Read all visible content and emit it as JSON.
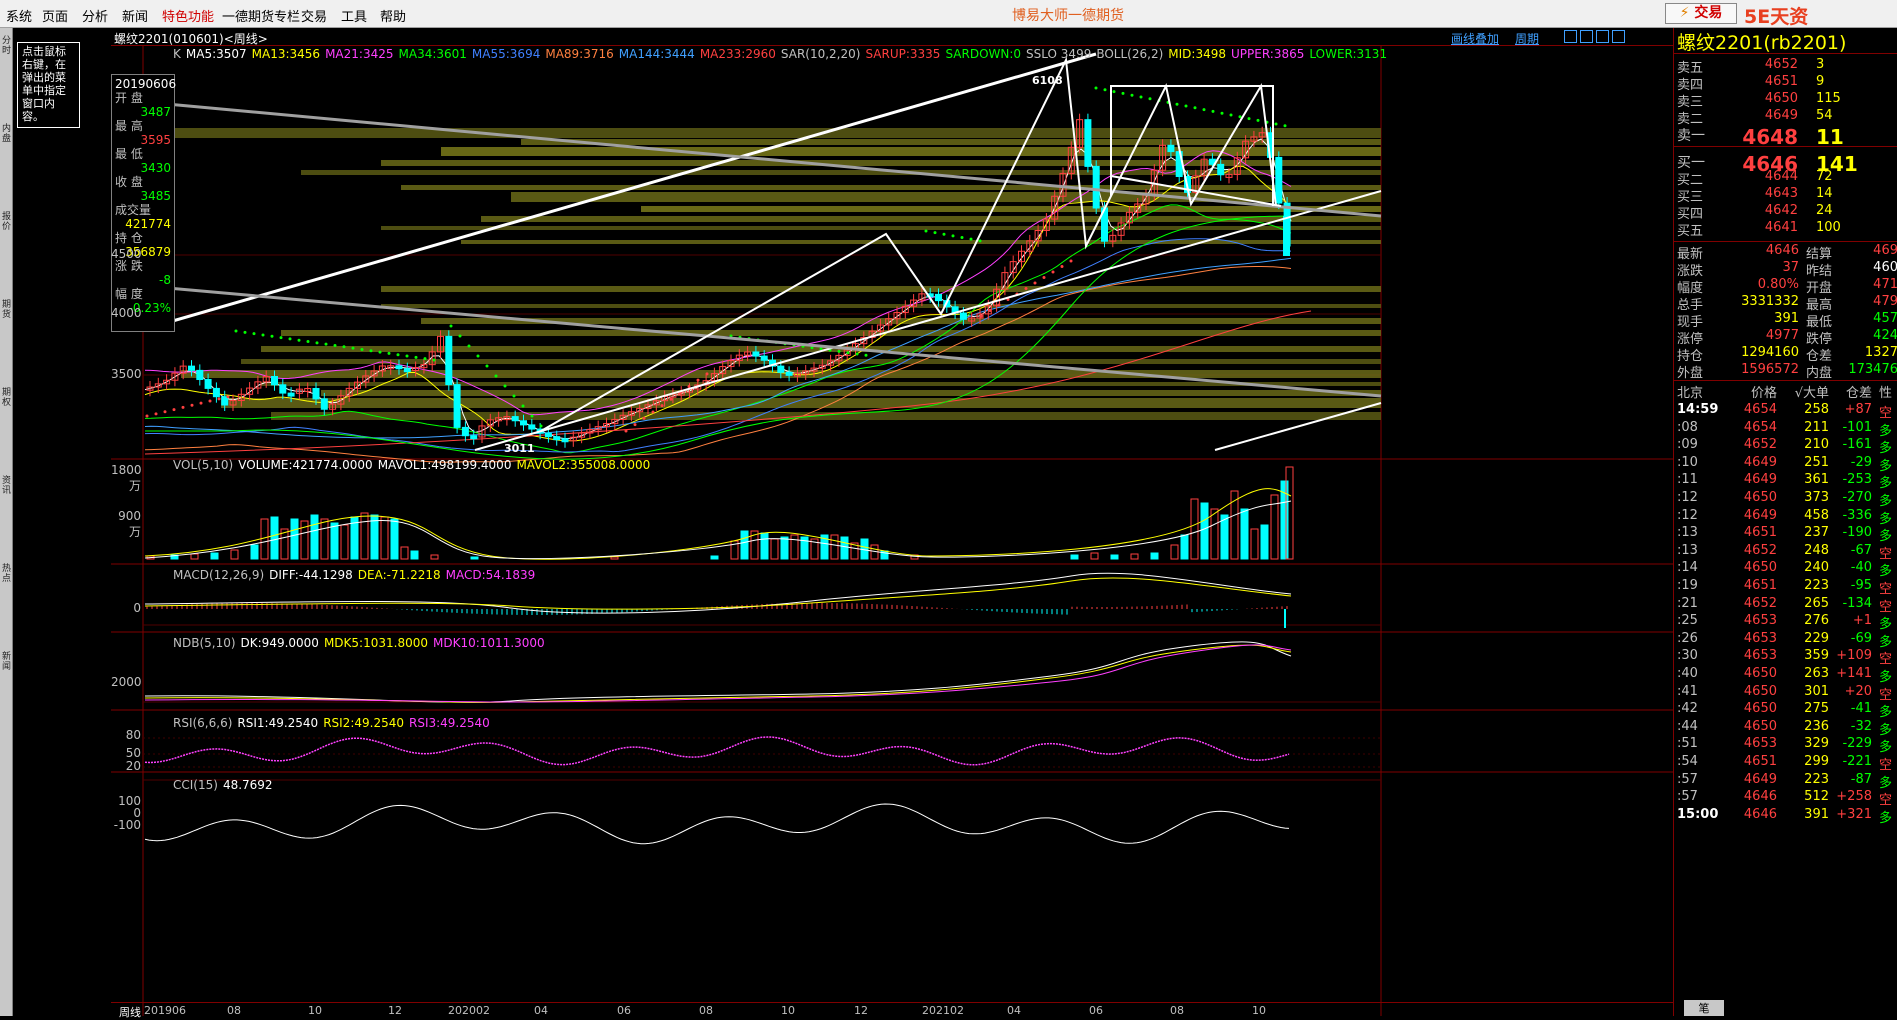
{
  "menu": [
    "系统",
    "页面",
    "分析",
    "新闻",
    "特色功能",
    "一德期货专栏",
    "交易",
    "工具",
    "帮助"
  ],
  "app_title": "博易大师一德期货",
  "trade_button": "交易",
  "watermark": "5E天资5etz.com",
  "left_tabs": [
    "分时",
    "内盘",
    "报价",
    "期货",
    "期权",
    "资讯",
    "热点",
    "新闻"
  ],
  "info_box": "点击鼠标右键，在弹出的菜单中指定窗口内容。",
  "chart": {
    "title": "螺纹2201(010601)<周线>",
    "links": [
      "画线叠加",
      "周期"
    ],
    "ma_line": [
      {
        "t": "K",
        "c": "#c0c0c0"
      },
      {
        "t": "MA5:3507",
        "c": "#ffffff"
      },
      {
        "t": "MA13:3456",
        "c": "#ffff00"
      },
      {
        "t": "MA21:3425",
        "c": "#ff40ff"
      },
      {
        "t": "MA34:3601",
        "c": "#00ff00"
      },
      {
        "t": "MA55:3694",
        "c": "#4080ff"
      },
      {
        "t": "MA89:3716",
        "c": "#ff8040"
      },
      {
        "t": "MA144:3444",
        "c": "#40a0ff"
      },
      {
        "t": "MA233:2960",
        "c": "#ff4040"
      },
      {
        "t": "SAR(10,2,20)",
        "c": "#c0c0c0"
      },
      {
        "t": "SARUP:3335",
        "c": "#ff4040"
      },
      {
        "t": "SARDOWN:0",
        "c": "#00ff00"
      },
      {
        "t": "SSLO 3499",
        "c": "#c0c0c0"
      },
      {
        "t": "BOLL(26,2)",
        "c": "#c0c0c0"
      },
      {
        "t": "MID:3498",
        "c": "#ffff00"
      },
      {
        "t": "UPPER:3865",
        "c": "#ff40ff"
      },
      {
        "t": "LOWER:3131",
        "c": "#00ff00"
      }
    ],
    "ohlc": [
      {
        "label": "20190606",
        "value": ""
      },
      {
        "label": "开  盘",
        "value": "3487",
        "color": "#00ff00"
      },
      {
        "label": "最  高",
        "value": "3595",
        "color": "#ff4040"
      },
      {
        "label": "最  低",
        "value": "3430",
        "color": "#00ff00"
      },
      {
        "label": "收  盘",
        "value": "3485",
        "color": "#00ff00"
      },
      {
        "label": "成交量",
        "value": "421774",
        "color": "#ffff00"
      },
      {
        "label": "持  仓",
        "value": "356879",
        "color": "#ffff00"
      },
      {
        "label": "涨  跌",
        "value": "-8",
        "color": "#00ff00"
      },
      {
        "label": "幅  度",
        "value": "-0.23%",
        "color": "#00ff00"
      }
    ],
    "price_ticks": [
      "4500",
      "4000",
      "3500"
    ],
    "annot_high": "6108",
    "annot_low": "3011",
    "vol": {
      "line": [
        {
          "t": "VOL(5,10)",
          "c": "#c0c0c0"
        },
        {
          "t": "VOLUME:421774.0000",
          "c": "#ffffff"
        },
        {
          "t": "MAVOL1:498199.4000",
          "c": "#ffffff"
        },
        {
          "t": "MAVOL2:355008.0000",
          "c": "#ffff00"
        }
      ],
      "ticks": [
        "1800万",
        "900万"
      ]
    },
    "macd": {
      "line": [
        {
          "t": "MACD(12,26,9)",
          "c": "#c0c0c0"
        },
        {
          "t": "DIFF:-44.1298",
          "c": "#ffffff"
        },
        {
          "t": "DEA:-71.2218",
          "c": "#ffff00"
        },
        {
          "t": "MACD:54.1839",
          "c": "#ff40ff"
        }
      ],
      "ticks": [
        "0"
      ]
    },
    "ndb": {
      "line": [
        {
          "t": "NDB(5,10)",
          "c": "#c0c0c0"
        },
        {
          "t": "DK:949.0000",
          "c": "#ffffff"
        },
        {
          "t": "MDK5:1031.8000",
          "c": "#ffff00"
        },
        {
          "t": "MDK10:1011.3000",
          "c": "#ff40ff"
        }
      ],
      "ticks": [
        "2000"
      ]
    },
    "rsi": {
      "line": [
        {
          "t": "RSI(6,6,6)",
          "c": "#c0c0c0"
        },
        {
          "t": "RSI1:49.2540",
          "c": "#ffffff"
        },
        {
          "t": "RSI2:49.2540",
          "c": "#ffff00"
        },
        {
          "t": "RSI3:49.2540",
          "c": "#ff40ff"
        }
      ],
      "ticks": [
        "80",
        "50",
        "20"
      ]
    },
    "cci": {
      "line": [
        {
          "t": "CCI(15)",
          "c": "#c0c0c0"
        },
        {
          "t": "48.7692",
          "c": "#ffffff"
        }
      ],
      "ticks": [
        "100",
        "0",
        "-100"
      ]
    },
    "x_labels": [
      "周线",
      "201906",
      "08",
      "10",
      "12",
      "202002",
      "04",
      "06",
      "08",
      "10",
      "12",
      "202102",
      "04",
      "06",
      "08",
      "10"
    ]
  },
  "quote": {
    "title": "螺纹2201(rb2201)",
    "asks": [
      {
        "label": "卖五",
        "price": "4652",
        "vol": "3"
      },
      {
        "label": "卖四",
        "price": "4651",
        "vol": "9"
      },
      {
        "label": "卖三",
        "price": "4650",
        "vol": "115"
      },
      {
        "label": "卖二",
        "price": "4649",
        "vol": "54"
      },
      {
        "label": "卖一",
        "price": "4648",
        "vol": "11"
      }
    ],
    "bids": [
      {
        "label": "买一",
        "price": "4646",
        "vol": "141"
      },
      {
        "label": "买二",
        "price": "4644",
        "vol": "72"
      },
      {
        "label": "买三",
        "price": "4643",
        "vol": "14"
      },
      {
        "label": "买四",
        "price": "4642",
        "vol": "24"
      },
      {
        "label": "买五",
        "price": "4641",
        "vol": "100"
      }
    ],
    "stats": [
      {
        "l1": "最新",
        "v1": "4646",
        "c1": "#ff4040",
        "l2": "结算",
        "v2": "469",
        "c2": "#ff4040"
      },
      {
        "l1": "涨跌",
        "v1": "37",
        "c1": "#ff4040",
        "l2": "昨结",
        "v2": "460",
        "c2": "#ffffff"
      },
      {
        "l1": "幅度",
        "v1": "0.80%",
        "c1": "#ff4040",
        "l2": "开盘",
        "v2": "471",
        "c2": "#ff4040"
      },
      {
        "l1": "总手",
        "v1": "3331332",
        "c1": "#ffff00",
        "l2": "最高",
        "v2": "479",
        "c2": "#ff4040"
      },
      {
        "l1": "现手",
        "v1": "391",
        "c1": "#ffff00",
        "l2": "最低",
        "v2": "457",
        "c2": "#00ff00"
      },
      {
        "l1": "涨停",
        "v1": "4977",
        "c1": "#ff4040",
        "l2": "跌停",
        "v2": "424",
        "c2": "#00ff00"
      },
      {
        "l1": "持仓",
        "v1": "1294160",
        "c1": "#ffff00",
        "l2": "仓差",
        "v2": "1327",
        "c2": "#ffff00"
      },
      {
        "l1": "外盘",
        "v1": "1596572",
        "c1": "#ff4040",
        "l2": "内盘",
        "v2": "173476",
        "c2": "#00ff00"
      }
    ],
    "tick_header": [
      "北京",
      "价格",
      "√大单",
      "仓差",
      "性"
    ],
    "ticks": [
      {
        "t": "14:59",
        "p": "4654",
        "v": "258",
        "d": "+87",
        "k": "空",
        "dc": "#ff4040",
        "kc": "#ff4040"
      },
      {
        "t": ":08",
        "p": "4654",
        "v": "211",
        "d": "-101",
        "k": "多",
        "dc": "#00ff00",
        "kc": "#00ff00"
      },
      {
        "t": ":09",
        "p": "4652",
        "v": "210",
        "d": "-161",
        "k": "多",
        "dc": "#00ff00",
        "kc": "#00ff00"
      },
      {
        "t": ":10",
        "p": "4649",
        "v": "251",
        "d": "-29",
        "k": "多",
        "dc": "#00ff00",
        "kc": "#00ff00"
      },
      {
        "t": ":11",
        "p": "4649",
        "v": "361",
        "d": "-253",
        "k": "多",
        "dc": "#00ff00",
        "kc": "#00ff00"
      },
      {
        "t": ":12",
        "p": "4650",
        "v": "373",
        "d": "-270",
        "k": "多",
        "dc": "#00ff00",
        "kc": "#00ff00"
      },
      {
        "t": ":12",
        "p": "4649",
        "v": "458",
        "d": "-336",
        "k": "多",
        "dc": "#00ff00",
        "kc": "#00ff00"
      },
      {
        "t": ":13",
        "p": "4651",
        "v": "237",
        "d": "-190",
        "k": "多",
        "dc": "#00ff00",
        "kc": "#00ff00"
      },
      {
        "t": ":13",
        "p": "4652",
        "v": "248",
        "d": "-67",
        "k": "空",
        "dc": "#00ff00",
        "kc": "#ff4040"
      },
      {
        "t": ":14",
        "p": "4650",
        "v": "240",
        "d": "-40",
        "k": "多",
        "dc": "#00ff00",
        "kc": "#00ff00"
      },
      {
        "t": ":19",
        "p": "4651",
        "v": "223",
        "d": "-95",
        "k": "空",
        "dc": "#00ff00",
        "kc": "#ff4040"
      },
      {
        "t": ":21",
        "p": "4652",
        "v": "265",
        "d": "-134",
        "k": "空",
        "dc": "#00ff00",
        "kc": "#ff4040"
      },
      {
        "t": ":25",
        "p": "4653",
        "v": "276",
        "d": "+1",
        "k": "多",
        "dc": "#ff4040",
        "kc": "#00ff00"
      },
      {
        "t": ":26",
        "p": "4653",
        "v": "229",
        "d": "-69",
        "k": "多",
        "dc": "#00ff00",
        "kc": "#00ff00"
      },
      {
        "t": ":30",
        "p": "4653",
        "v": "359",
        "d": "+109",
        "k": "空",
        "dc": "#ff4040",
        "kc": "#ff4040"
      },
      {
        "t": ":40",
        "p": "4650",
        "v": "263",
        "d": "+141",
        "k": "多",
        "dc": "#ff4040",
        "kc": "#00ff00"
      },
      {
        "t": ":41",
        "p": "4650",
        "v": "301",
        "d": "+20",
        "k": "空",
        "dc": "#ff4040",
        "kc": "#ff4040"
      },
      {
        "t": ":42",
        "p": "4650",
        "v": "275",
        "d": "-41",
        "k": "多",
        "dc": "#00ff00",
        "kc": "#00ff00"
      },
      {
        "t": ":44",
        "p": "4650",
        "v": "236",
        "d": "-32",
        "k": "多",
        "dc": "#00ff00",
        "kc": "#00ff00"
      },
      {
        "t": ":51",
        "p": "4653",
        "v": "329",
        "d": "-229",
        "k": "多",
        "dc": "#00ff00",
        "kc": "#00ff00"
      },
      {
        "t": ":54",
        "p": "4651",
        "v": "299",
        "d": "-221",
        "k": "空",
        "dc": "#00ff00",
        "kc": "#ff4040"
      },
      {
        "t": ":57",
        "p": "4649",
        "v": "223",
        "d": "-87",
        "k": "多",
        "dc": "#00ff00",
        "kc": "#00ff00"
      },
      {
        "t": ":57",
        "p": "4646",
        "v": "512",
        "d": "+258",
        "k": "空",
        "dc": "#ff4040",
        "kc": "#ff4040"
      },
      {
        "t": "15:00",
        "p": "4646",
        "v": "391",
        "d": "+321",
        "k": "多",
        "dc": "#ff4040",
        "kc": "#00ff00"
      }
    ],
    "bottom_tab": "笔"
  }
}
